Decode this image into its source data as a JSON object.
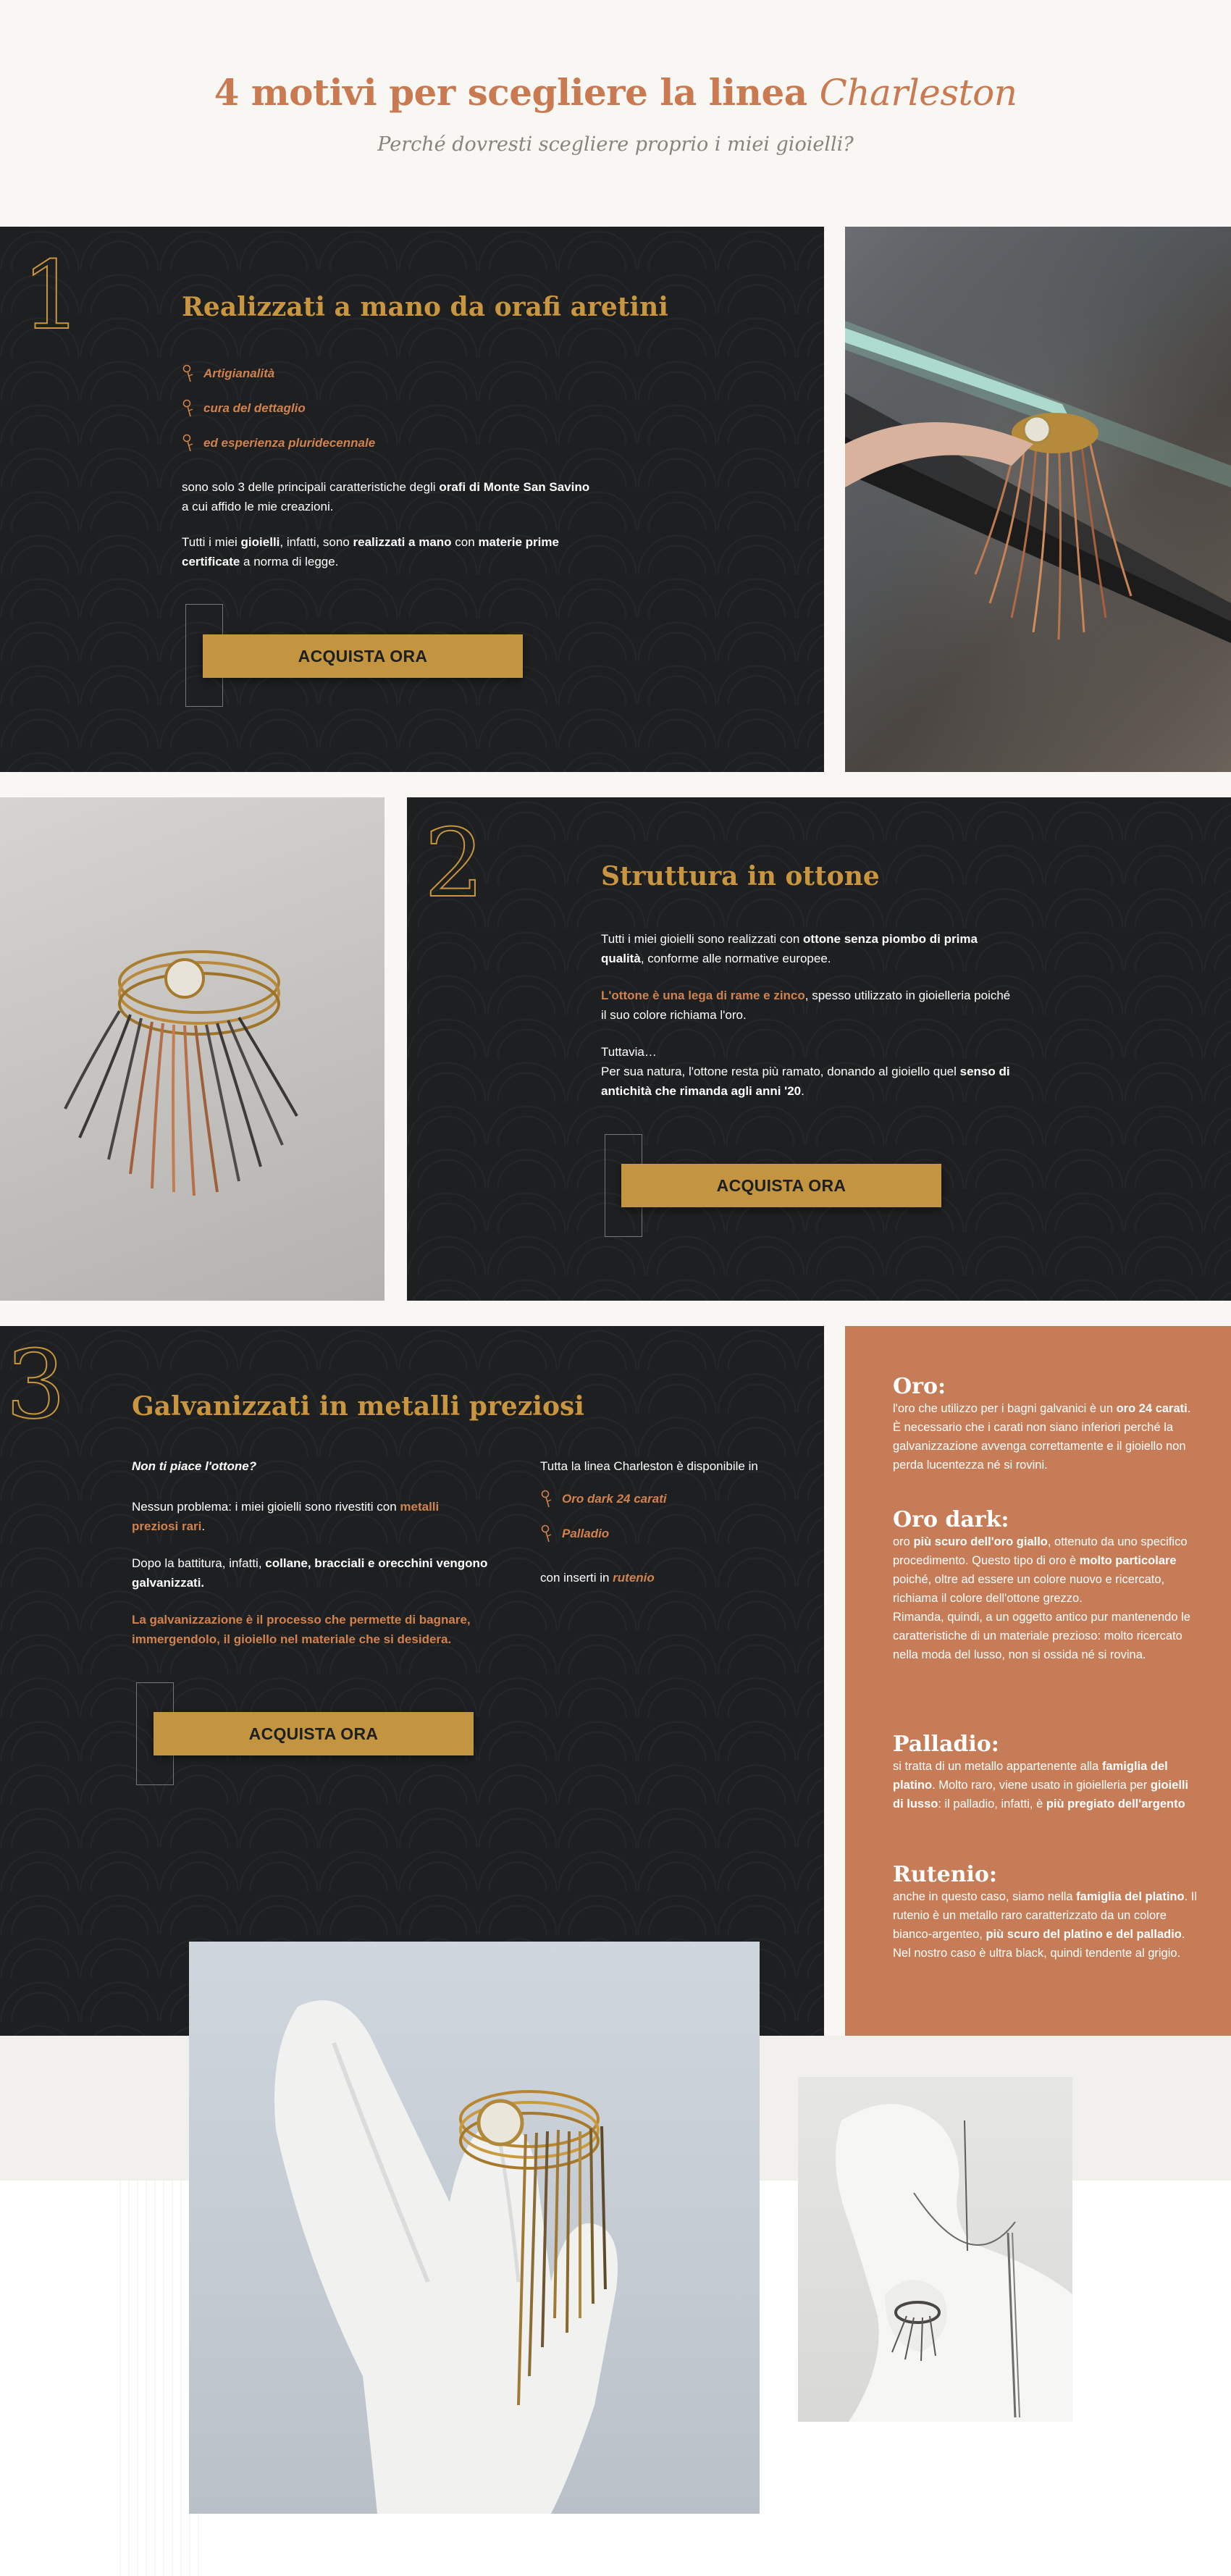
{
  "header": {
    "title_main": "4 motivi per scegliere la linea ",
    "title_italic": "Charleston",
    "subtitle": "Perché dovresti scegliere proprio i miei gioielli?"
  },
  "section1": {
    "number": "1",
    "title": "Realizzati a mano da orafi aretini",
    "bullets": [
      "Artigianalità",
      "cura del dettaglio",
      "ed esperienza pluridecennale"
    ],
    "p1_a": "sono solo 3 delle principali caratteristiche degli ",
    "p1_b": "orafi di Monte San Savino",
    "p1_c": "a cui affido le mie creazioni.",
    "p2_a": "Tutti i miei ",
    "p2_b": "gioielli",
    "p2_c": ", infatti, sono ",
    "p2_d": "realizzati a mano",
    "p2_e": " con ",
    "p2_f": "materie prime",
    "p2_g": "certificate",
    "p2_h": " a norma di legge.",
    "button": "ACQUISTA ORA"
  },
  "section2": {
    "number": "2",
    "title": "Struttura in ottone",
    "p1_a": "Tutti i miei gioielli sono realizzati con ",
    "p1_b": "ottone senza piombo di prima",
    "p1_c": "qualità",
    "p1_d": ", conforme alle normative europee.",
    "p2_a": "L'ottone è una lega di rame e zinco",
    "p2_b": ", spesso utilizzato in gioielleria poiché",
    "p2_c": "il suo colore richiama l'oro.",
    "p3_a": "Tuttavia…",
    "p3_b": "Per sua natura, l'ottone resta più ramato, donando al gioiello quel ",
    "p3_c": "senso di",
    "p3_d": "antichità che rimanda agli anni '20",
    "p3_e": ".",
    "button": "ACQUISTA ORA"
  },
  "section3": {
    "number": "3",
    "title": "Galvanizzati in metalli preziosi",
    "q": "Non ti piace l'ottone?",
    "p1_a": "Nessun problema: i miei gioielli sono rivestiti con ",
    "p1_b": "metalli",
    "p1_c": "preziosi rari",
    "p1_d": ".",
    "p2_a": "Dopo la battitura, infatti, ",
    "p2_b": "collane, bracciali e orecchini vengono",
    "p2_c": "galvanizzati.",
    "p3_a": "La galvanizzazione è il processo che permette di bagnare,",
    "p3_b": "immergendolo, il gioiello nel materiale che si desidera.",
    "right_intro": "Tutta la linea Charleston è disponibile in",
    "bullets": [
      "Oro dark 24 carati",
      "Palladio"
    ],
    "inserts_a": "con inserti in ",
    "inserts_b": "rutenio",
    "button": "ACQUISTA ORA"
  },
  "metals": {
    "oro": {
      "title": "Oro:",
      "t1": "l'oro che utilizzo per i bagni galvanici è un ",
      "t2": "oro 24",
      "t3": "carati",
      "t4": ". È necessario che i carati non siano inferiori perché la galvanizzazione avvenga correttamente e il gioiello non perda lucentezza né si rovini."
    },
    "oro_dark": {
      "title": "Oro dark:",
      "t1": "oro ",
      "t2": "più scuro dell'oro giallo",
      "t3": ", ottenuto da uno specifico procedimento. Questo tipo di oro è ",
      "t4": "molto particolare",
      "t5": " poiché, oltre ad essere un colore nuovo e ricercato, richiama il colore dell'ottone grezzo.",
      "t6": "Rimanda, quindi, a un oggetto antico pur mantenendo le caratteristiche di un materiale prezioso: molto ricercato nella moda del lusso, non si ossida né si rovina."
    },
    "palladio": {
      "title": "Palladio:",
      "t1": "si tratta di un metallo appartenente alla ",
      "t2": "famiglia del platino",
      "t3": ". Molto raro, viene usato in gioielleria per ",
      "t4": "gioielli di lusso",
      "t5": ": il palladio, infatti, è ",
      "t6": "più pregiato dell'argento"
    },
    "rutenio": {
      "title": "Rutenio:",
      "t1": "anche in questo caso, siamo nella ",
      "t2": "famiglia del platino",
      "t3": ". Il rutenio è un metallo raro caratterizzato da un colore bianco-argenteo, ",
      "t4": "più scuro del platino e del palladio",
      "t5": ". Nel nostro caso è ultra black, quindi tendente al grigio."
    }
  },
  "colors": {
    "dark_bg": "#1d1f20",
    "gold": "#c9963f",
    "copper": "#c67c57",
    "accent_text": "#d0824f",
    "page_bg": "#f8f7f4"
  }
}
